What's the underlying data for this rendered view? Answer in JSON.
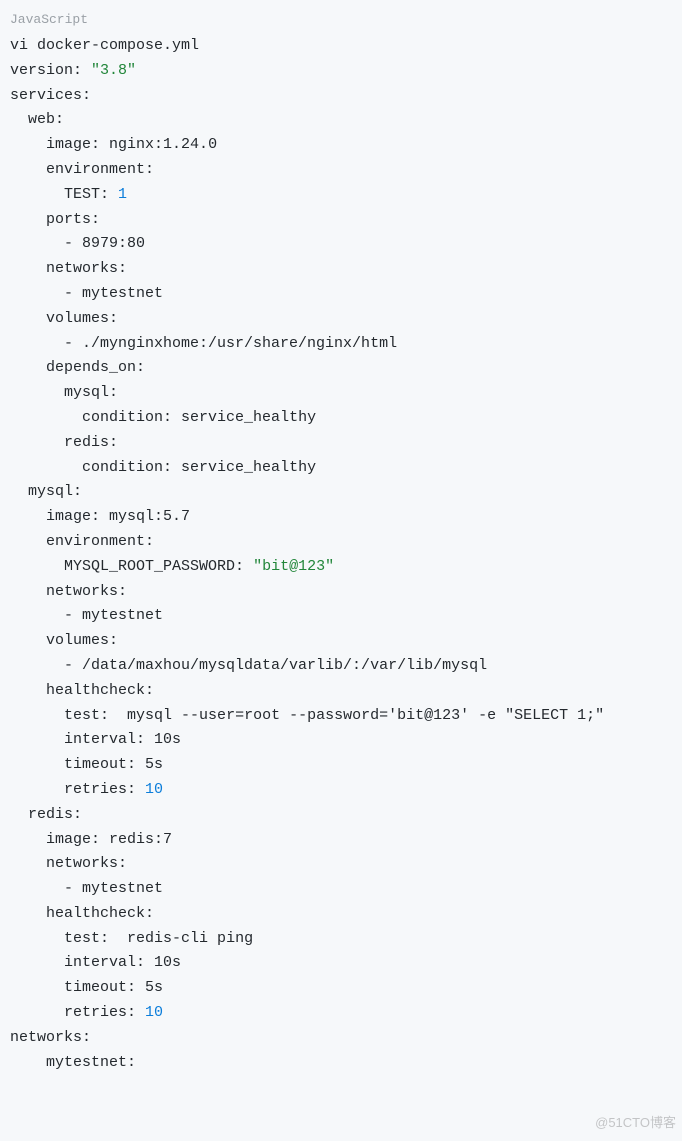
{
  "lang_label": "JavaScript",
  "cmd": "vi docker-compose.yml",
  "version_key": "version:",
  "version_val": "\"3.8\"",
  "services_key": "services:",
  "web": {
    "name": "web:",
    "image_key": "image:",
    "image_val": "nginx:1.24.0",
    "environment_key": "environment:",
    "env_key": "TEST:",
    "env_val": "1",
    "ports_key": "ports:",
    "port_val": "8979:80",
    "networks_key": "networks:",
    "network_val": "mytestnet",
    "volumes_key": "volumes:",
    "volume_val": "./mynginxhome:/usr/share/nginx/html",
    "depends_on_key": "depends_on:",
    "mysql_dep": "mysql:",
    "redis_dep": "redis:",
    "condition_key": "condition:",
    "condition_val": "service_healthy"
  },
  "mysql": {
    "name": "mysql:",
    "image_key": "image:",
    "image_val": "mysql:5.7",
    "environment_key": "environment:",
    "env_key": "MYSQL_ROOT_PASSWORD:",
    "env_val": "\"bit@123\"",
    "networks_key": "networks:",
    "network_val": "mytestnet",
    "volumes_key": "volumes:",
    "volume_val": "/data/maxhou/mysqldata/varlib/:/var/lib/mysql",
    "healthcheck_key": "healthcheck:",
    "test_key": "test:",
    "test_val": "mysql --user=root --password='bit@123' -e \"SELECT 1;\"",
    "interval_key": "interval:",
    "interval_val": "10s",
    "timeout_key": "timeout:",
    "timeout_val": "5s",
    "retries_key": "retries:",
    "retries_val": "10"
  },
  "redis": {
    "name": "redis:",
    "image_key": "image:",
    "image_val": "redis:7",
    "networks_key": "networks:",
    "network_val": "mytestnet",
    "healthcheck_key": "healthcheck:",
    "test_key": "test:",
    "test_val": "redis-cli ping",
    "interval_key": "interval:",
    "interval_val": "10s",
    "timeout_key": "timeout:",
    "timeout_val": "5s",
    "retries_key": "retries:",
    "retries_val": "10"
  },
  "networks_root_key": "networks:",
  "networks_root_val": "mytestnet:",
  "watermark": "@51CTO博客"
}
